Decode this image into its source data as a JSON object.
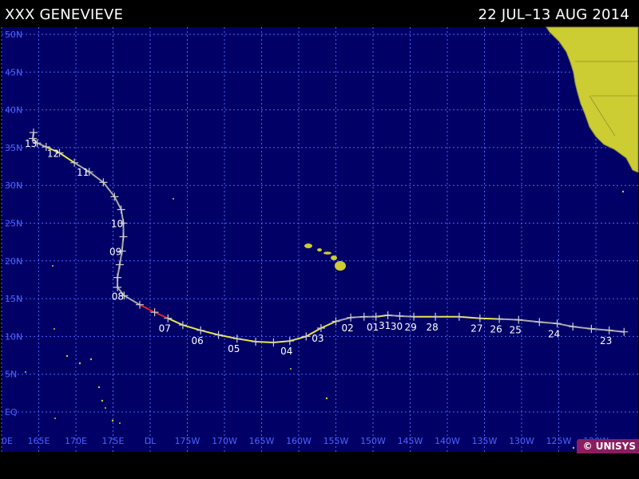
{
  "title": {
    "storm": "XXX GENEVIEVE",
    "date_range": "22 JUL–13 AUG 2014"
  },
  "map": {
    "ocean_color": "#000066",
    "grid_color": "#4d63ff",
    "land_color": "#cccc33",
    "label_color": "#4d63ff",
    "lat_labels": [
      "50N",
      "45N",
      "40N",
      "35N",
      "30N",
      "25N",
      "20N",
      "15N",
      "10N",
      "5N",
      "EQ"
    ],
    "lon_labels": [
      "0E",
      "165E",
      "170E",
      "175E",
      "DL",
      "175W",
      "170W",
      "165W",
      "160W",
      "155W",
      "150W",
      "145W",
      "140W",
      "135W",
      "130W",
      "125W",
      "120W"
    ]
  },
  "track": {
    "colors": {
      "depression": "#aaaaaa",
      "storm": "#e8e84a",
      "hurricane": "#dd2222"
    },
    "points": [
      {
        "lon": -116.2,
        "lat": 10.6,
        "stage": "depression"
      },
      {
        "lon": -118.2,
        "lat": 10.8,
        "stage": "depression"
      },
      {
        "lon": -120.6,
        "lat": 11.0,
        "stage": "depression"
      },
      {
        "lon": -123.1,
        "lat": 11.3,
        "stage": "depression"
      },
      {
        "lon": -125.2,
        "lat": 11.7,
        "stage": "depression"
      },
      {
        "lon": -127.6,
        "lat": 11.9,
        "stage": "depression"
      },
      {
        "lon": -130.4,
        "lat": 12.2,
        "stage": "depression"
      },
      {
        "lon": -133.0,
        "lat": 12.3,
        "stage": "storm"
      },
      {
        "lon": -135.6,
        "lat": 12.4,
        "stage": "storm"
      },
      {
        "lon": -138.4,
        "lat": 12.6,
        "stage": "storm"
      },
      {
        "lon": -141.6,
        "lat": 12.6,
        "stage": "storm"
      },
      {
        "lon": -144.5,
        "lat": 12.6,
        "stage": "depression"
      },
      {
        "lon": -146.4,
        "lat": 12.7,
        "stage": "depression"
      },
      {
        "lon": -148.0,
        "lat": 12.8,
        "stage": "storm"
      },
      {
        "lon": -149.6,
        "lat": 12.6,
        "stage": "depression"
      },
      {
        "lon": -151.2,
        "lat": 12.6,
        "stage": "depression"
      },
      {
        "lon": -153.0,
        "lat": 12.5,
        "stage": "depression"
      },
      {
        "lon": -155.0,
        "lat": 12.0,
        "stage": "storm"
      },
      {
        "lon": -157.0,
        "lat": 11.1,
        "stage": "storm"
      },
      {
        "lon": -159.0,
        "lat": 10.0,
        "stage": "storm"
      },
      {
        "lon": -161.2,
        "lat": 9.4,
        "stage": "storm"
      },
      {
        "lon": -163.4,
        "lat": 9.2,
        "stage": "storm"
      },
      {
        "lon": -165.8,
        "lat": 9.3,
        "stage": "storm"
      },
      {
        "lon": -168.3,
        "lat": 9.7,
        "stage": "storm"
      },
      {
        "lon": -170.8,
        "lat": 10.2,
        "stage": "storm"
      },
      {
        "lon": -173.2,
        "lat": 10.8,
        "stage": "storm"
      },
      {
        "lon": -175.6,
        "lat": 11.5,
        "stage": "storm"
      },
      {
        "lon": -177.6,
        "lat": 12.4,
        "stage": "hurricane"
      },
      {
        "lon": -179.4,
        "lat": 13.2,
        "stage": "hurricane"
      },
      {
        "lon": 178.6,
        "lat": 14.2,
        "stage": "depression"
      },
      {
        "lon": 176.5,
        "lat": 15.4,
        "stage": "depression"
      },
      {
        "lon": 175.6,
        "lat": 16.5,
        "stage": "depression"
      },
      {
        "lon": 175.6,
        "lat": 17.8,
        "stage": "depression"
      },
      {
        "lon": 175.9,
        "lat": 19.5,
        "stage": "depression"
      },
      {
        "lon": 176.2,
        "lat": 21.3,
        "stage": "depression"
      },
      {
        "lon": 176.4,
        "lat": 23.2,
        "stage": "depression"
      },
      {
        "lon": 176.4,
        "lat": 25.0,
        "stage": "depression"
      },
      {
        "lon": 176.1,
        "lat": 26.8,
        "stage": "depression"
      },
      {
        "lon": 175.2,
        "lat": 28.5,
        "stage": "depression"
      },
      {
        "lon": 173.7,
        "lat": 30.4,
        "stage": "depression"
      },
      {
        "lon": 171.8,
        "lat": 31.8,
        "stage": "depression"
      },
      {
        "lon": 169.8,
        "lat": 33.0,
        "stage": "storm"
      },
      {
        "lon": 167.8,
        "lat": 34.3,
        "stage": "storm"
      },
      {
        "lon": 166.0,
        "lat": 35.1,
        "stage": "depression"
      },
      {
        "lon": 164.8,
        "lat": 35.6,
        "stage": "depression"
      },
      {
        "lon": 164.2,
        "lat": 36.2,
        "stage": "depression"
      },
      {
        "lon": 164.3,
        "lat": 37.0,
        "stage": "depression"
      }
    ],
    "day_labels": [
      {
        "text": "23",
        "lon": -118.2,
        "lat": 10.8
      },
      {
        "text": "24",
        "lon": -125.2,
        "lat": 11.7
      },
      {
        "text": "25",
        "lon": -130.4,
        "lat": 12.2
      },
      {
        "text": "26",
        "lon": -133.0,
        "lat": 12.3
      },
      {
        "text": "27",
        "lon": -135.6,
        "lat": 12.4
      },
      {
        "text": "28",
        "lon": -141.6,
        "lat": 12.6
      },
      {
        "text": "29",
        "lon": -144.5,
        "lat": 12.6
      },
      {
        "text": "30",
        "lon": -146.4,
        "lat": 12.7
      },
      {
        "text": "31",
        "lon": -148.0,
        "lat": 12.8
      },
      {
        "text": "01",
        "lon": -149.6,
        "lat": 12.6
      },
      {
        "text": "02",
        "lon": -153.0,
        "lat": 12.5
      },
      {
        "text": "03",
        "lon": -157.0,
        "lat": 11.1
      },
      {
        "text": "04",
        "lon": -161.2,
        "lat": 9.4
      },
      {
        "text": "05",
        "lon": -168.3,
        "lat": 9.7
      },
      {
        "text": "06",
        "lon": -173.2,
        "lat": 10.8
      },
      {
        "text": "07",
        "lon": -177.6,
        "lat": 12.4
      },
      {
        "text": "08",
        "lon": 176.5,
        "lat": 15.4
      },
      {
        "text": "09",
        "lon": 176.2,
        "lat": 21.3
      },
      {
        "text": "10",
        "lon": 176.4,
        "lat": 25.0
      },
      {
        "text": "11",
        "lon": 171.8,
        "lat": 31.8
      },
      {
        "text": "12",
        "lon": 167.8,
        "lat": 34.3
      },
      {
        "text": "13",
        "lon": 164.8,
        "lat": 35.6
      }
    ]
  },
  "watermark": "© UNISYS"
}
